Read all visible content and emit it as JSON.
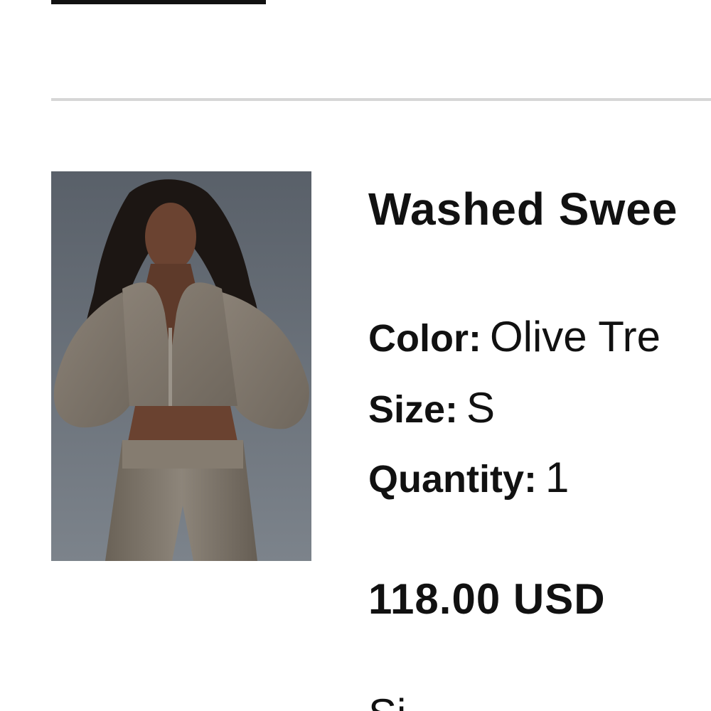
{
  "product": {
    "name": "Washed Swee",
    "color_label": "Color:",
    "color_value": "Olive Tre",
    "size_label": "Size:",
    "size_value": "S",
    "quantity_label": "Quantity:",
    "quantity_value": "1",
    "price": "118.00 USD",
    "image_icon": "product-photo"
  },
  "footer": {
    "partial_text": "Si"
  }
}
